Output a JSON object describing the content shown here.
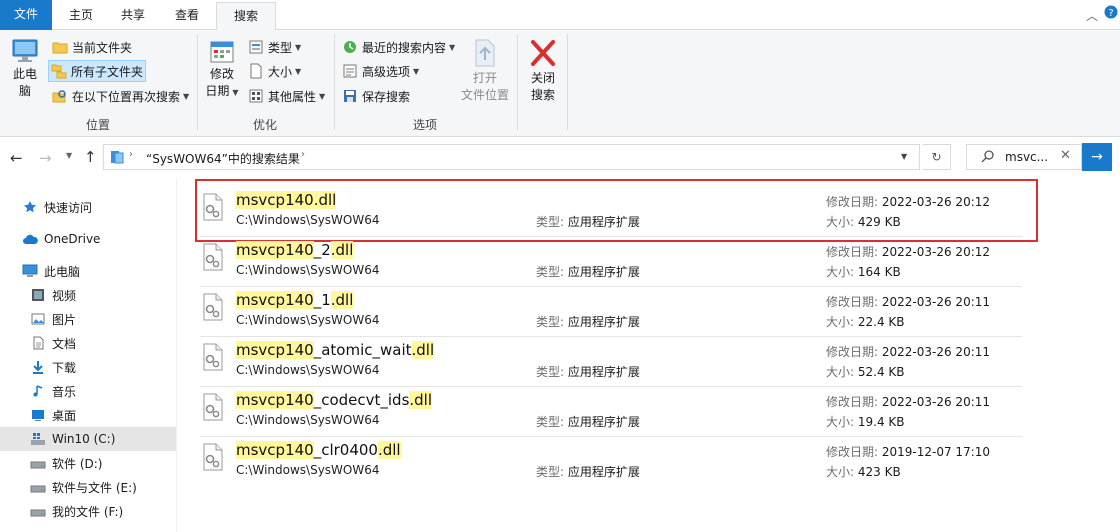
{
  "tabs": {
    "file": "文件",
    "home": "主页",
    "share": "共享",
    "view": "查看",
    "search": "搜索"
  },
  "ribbon": {
    "this_pc": [
      "此电",
      "脑"
    ],
    "location": {
      "current_folder": "当前文件夹",
      "all_subfolders": "所有子文件夹",
      "search_again": "在以下位置再次搜索",
      "label": "位置"
    },
    "refine": {
      "date_modified": [
        "修改",
        "日期"
      ],
      "kind": "类型",
      "size": "大小",
      "other_props": "其他属性",
      "label": "优化"
    },
    "options": {
      "recent_searches": "最近的搜索内容",
      "advanced": "高级选项",
      "save_search": "保存搜索",
      "open_location": [
        "打开",
        "文件位置"
      ],
      "label": "选项"
    },
    "close_search": [
      "关闭",
      "搜索"
    ]
  },
  "address": {
    "path": "“SysWOW64”中的搜索结果",
    "search_value": "msvc..."
  },
  "nav": [
    {
      "label": "快速访问",
      "icon": "star-icon",
      "indent": 0
    },
    {
      "label": "OneDrive",
      "icon": "cloud-icon",
      "indent": 0
    },
    {
      "label": "此电脑",
      "icon": "computer-icon",
      "indent": 0
    },
    {
      "label": "视频",
      "icon": "video-icon",
      "indent": 1
    },
    {
      "label": "图片",
      "icon": "picture-icon",
      "indent": 1
    },
    {
      "label": "文档",
      "icon": "document-icon",
      "indent": 1
    },
    {
      "label": "下载",
      "icon": "download-icon",
      "indent": 1
    },
    {
      "label": "音乐",
      "icon": "music-icon",
      "indent": 1
    },
    {
      "label": "桌面",
      "icon": "desktop-icon",
      "indent": 1
    },
    {
      "label": "Win10 (C:)",
      "icon": "windows-drive-icon",
      "indent": 1,
      "selected": true
    },
    {
      "label": "软件 (D:)",
      "icon": "drive-icon",
      "indent": 1
    },
    {
      "label": "软件与文件 (E:)",
      "icon": "drive-icon",
      "indent": 1
    },
    {
      "label": "我的文件 (F:)",
      "icon": "drive-icon",
      "indent": 1
    }
  ],
  "labels": {
    "type": "类型:",
    "modified": "修改日期:",
    "size": "大小:"
  },
  "results": [
    {
      "name_match": "msvcp140.dll",
      "name_rest": "",
      "path": "C:\\Windows\\SysWOW64",
      "kind": "应用程序扩展",
      "date": "2022-03-26 20:12",
      "size": "429 KB",
      "highlighted": true
    },
    {
      "name_match": "msvcp140",
      "name_rest": "_2",
      "name_ext": ".dll",
      "path": "C:\\Windows\\SysWOW64",
      "kind": "应用程序扩展",
      "date": "2022-03-26 20:12",
      "size": "164 KB"
    },
    {
      "name_match": "msvcp140",
      "name_rest": "_1",
      "name_ext": ".dll",
      "path": "C:\\Windows\\SysWOW64",
      "kind": "应用程序扩展",
      "date": "2022-03-26 20:11",
      "size": "22.4 KB"
    },
    {
      "name_match": "msvcp140",
      "name_rest": "_atomic_wait",
      "name_ext": ".dll",
      "path": "C:\\Windows\\SysWOW64",
      "kind": "应用程序扩展",
      "date": "2022-03-26 20:11",
      "size": "52.4 KB"
    },
    {
      "name_match": "msvcp140",
      "name_rest": "_codecvt_ids",
      "name_ext": ".dll",
      "path": "C:\\Windows\\SysWOW64",
      "kind": "应用程序扩展",
      "date": "2022-03-26 20:11",
      "size": "19.4 KB"
    },
    {
      "name_match": "msvcp140",
      "name_rest": "_clr0400",
      "name_ext": ".dll",
      "path": "C:\\Windows\\SysWOW64",
      "kind": "应用程序扩展",
      "date": "2019-12-07 17:10",
      "size": "423 KB"
    }
  ]
}
